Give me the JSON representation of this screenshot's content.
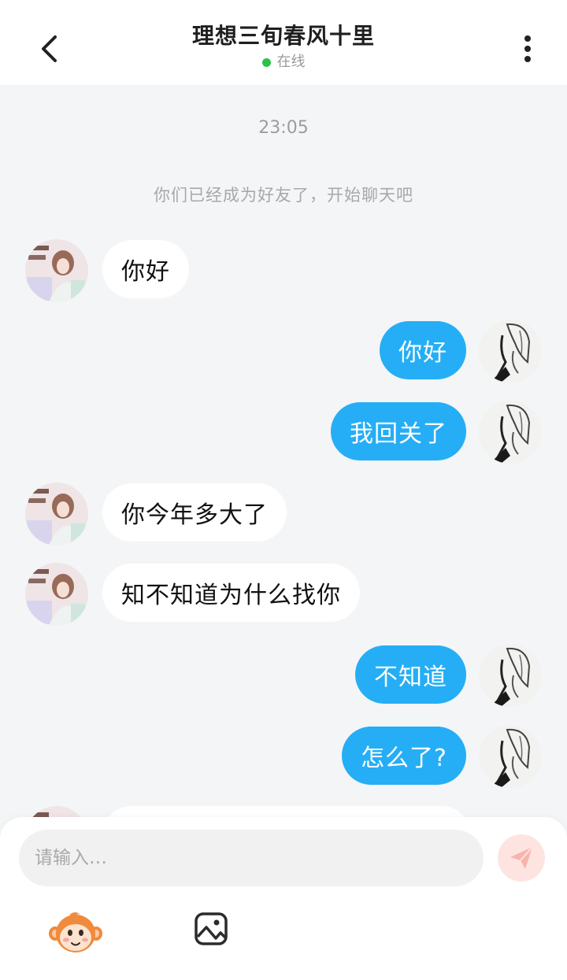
{
  "header": {
    "title": "理想三旬春风十里",
    "status": "在线",
    "status_color": "#2bc24a"
  },
  "chat": {
    "time": "23:05",
    "system_notice": "你们已经成为好友了，开始聊天吧",
    "messages": [
      {
        "from": "other",
        "text": "你好"
      },
      {
        "from": "me",
        "text": "你好"
      },
      {
        "from": "me",
        "text": "我回关了"
      },
      {
        "from": "other",
        "text": "你今年多大了"
      },
      {
        "from": "other",
        "text": "知不知道为什么找你"
      },
      {
        "from": "me",
        "text": "不知道"
      },
      {
        "from": "me",
        "text": "怎么了?"
      }
    ]
  },
  "composer": {
    "placeholder": "请输入…",
    "send_icon": "paper-plane-icon",
    "emoji_icon": "monkey-sticker-icon",
    "image_icon": "image-icon"
  },
  "colors": {
    "outgoing_bubble": "#25aef5",
    "incoming_bubble": "#ffffff",
    "background": "#f4f5f7",
    "send_button": "#fde4e1"
  }
}
